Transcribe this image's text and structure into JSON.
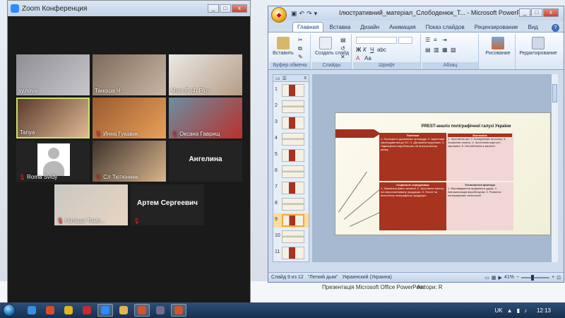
{
  "desktop": {
    "explorer_lines": [
      "Презентація Microsoft Office PowerPoint",
      "Автори: R"
    ]
  },
  "zoom": {
    "title": "Zoom Конференция",
    "participants": [
      {
        "name": "sy.nova",
        "muted": false,
        "video": true,
        "active": false,
        "photo": [
          "#8e8e95",
          "#c7c7cb"
        ]
      },
      {
        "name": "Таноша Ч",
        "muted": false,
        "video": true,
        "active": false,
        "photo": [
          "#7d6a5a",
          "#c9b6a3"
        ]
      },
      {
        "name": "Moto E (4) Plus",
        "muted": false,
        "video": true,
        "active": false,
        "photo": [
          "#eae9e4",
          "#b69c86"
        ]
      },
      {
        "name": "Tanya",
        "muted": false,
        "video": true,
        "active": true,
        "photo": [
          "#5a3b2c",
          "#e0b892"
        ]
      },
      {
        "name": "Инна Гукавик",
        "muted": true,
        "video": true,
        "active": false,
        "photo": [
          "#9a5a2f",
          "#e8a15a"
        ]
      },
      {
        "name": "Оксана Гаврищ",
        "muted": true,
        "video": true,
        "active": false,
        "photo": [
          "#6b8ea3",
          "#b9312a"
        ]
      },
      {
        "name": "Roma Svidy",
        "muted": true,
        "video": false,
        "active": false,
        "photo": []
      },
      {
        "name": "Сл Тютюнник",
        "muted": true,
        "video": true,
        "active": false,
        "photo": [
          "#3f332a",
          "#d8b58e"
        ]
      },
      {
        "name": "Ангелина",
        "muted": false,
        "video": false,
        "active": false,
        "photo": []
      },
      {
        "name": "Наташа Тимо...",
        "muted": true,
        "video": true,
        "active": false,
        "photo": [
          "#c9c7c3",
          "#e8d5c2"
        ]
      },
      {
        "name": "Артем Сергеевич",
        "muted": true,
        "video": false,
        "active": false,
        "photo": []
      }
    ]
  },
  "ppt": {
    "title": "Ілюстративний_матеріал_Слободенюк_Т... - Microsoft PowerPoint",
    "tabs": [
      "Главная",
      "Вставка",
      "Дизайн",
      "Анимация",
      "Показ слайдов",
      "Рецензирование",
      "Вид"
    ],
    "active_tab": "Главная",
    "ribbon": {
      "paste_label": "Вставить",
      "clipboard_group": "Буфер обмена",
      "new_slide_label": "Создать слайд",
      "slides_group": "Слайды",
      "font_group": "Шрифт",
      "paragraph_group": "Абзац",
      "drawing_label": "Рисование",
      "editing_label": "Редактирование"
    },
    "slide_numbers": [
      "1",
      "2",
      "3",
      "4",
      "5",
      "6",
      "7",
      "8",
      "9",
      "10",
      "11"
    ],
    "selected_slide": "9",
    "slide": {
      "title": "PREST-аналіз поліграфічної галузі України",
      "quadrants": [
        {
          "heading": "Політика",
          "body": "1. Прозорість державних процедур; 2. Адаптація законодавства до ЄС; 3. Державна підтримка; 4. Підвищення виробництва на внутрішньому ринку."
        },
        {
          "heading": "Економіка",
          "body": "1. Зростання цін; 2. Конкуренція на ринку; 3. Зниження попиту; 4. Зростання вартості сировини; 5. Нестабільність валюти."
        },
        {
          "heading": "Соціальне середовище",
          "body": "1. Зниження рівня читання; 2. Зростання попиту на персоналізовану продукцію; 3. Попит на екологічну поліграфічну продукцію."
        },
        {
          "heading": "Технологічні фактори",
          "body": "1. Впровадження цифрового друку; 2. Автоматизація виробництва; 3. Розвиток поліграфічних технологій."
        }
      ]
    },
    "status": {
      "slide": "Слайд 9 из 12",
      "theme": "\"Легкий дым\"",
      "language": "Украинский (Украина)",
      "zoom": "41%"
    }
  },
  "taskbar": {
    "apps": [
      "ie",
      "shield",
      "chrome",
      "pdf",
      "zoom",
      "folder",
      "ppt",
      "media",
      "ppt2"
    ],
    "lang": "UK",
    "clock": "12:13"
  },
  "colors": {
    "slide_red": "#a8331f",
    "slide_pink": "#f1d6d6",
    "active_speaker": "#c7e36b"
  }
}
